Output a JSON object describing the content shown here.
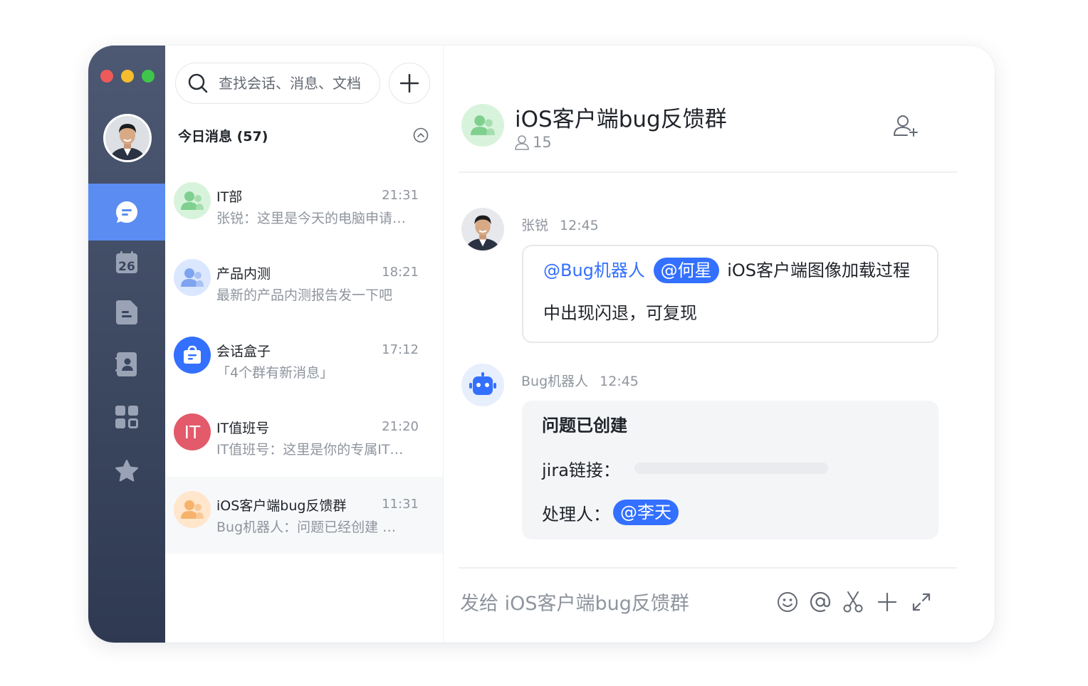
{
  "sidebar": {
    "profile": "avatar",
    "nav": [
      {
        "id": "chat",
        "icon": "chat-bubble-icon",
        "active": true
      },
      {
        "id": "calendar",
        "icon": "calendar-icon",
        "label": "26"
      },
      {
        "id": "docs",
        "icon": "document-icon"
      },
      {
        "id": "contacts",
        "icon": "contacts-icon"
      },
      {
        "id": "workplace",
        "icon": "app-grid-icon"
      },
      {
        "id": "favorites",
        "icon": "star-icon"
      }
    ]
  },
  "search": {
    "placeholder": "查找会话、消息、文档"
  },
  "list": {
    "section_title": "今日消息 (57)",
    "conversations": [
      {
        "name": "IT部",
        "time": "21:31",
        "preview": "张锐：这里是今天的电脑申请…",
        "avatar": "group-icon",
        "avatar_color": "#d8f3dc"
      },
      {
        "name": "产品内测",
        "time": "18:21",
        "preview": "最新的产品内测报告发一下吧",
        "avatar": "group-icon",
        "avatar_color": "#dbe7ff"
      },
      {
        "name": "会话盒子",
        "time": "17:12",
        "preview": "「4个群有新消息」",
        "avatar": "inbox-icon",
        "avatar_color": "#3370ff"
      },
      {
        "name": "IT值班号",
        "time": "21:20",
        "preview": "IT值班号：这里是你的专属IT…",
        "avatar_text": "IT",
        "avatar_color": "#e35a6a"
      },
      {
        "name": "iOS客户端bug反馈群",
        "time": "11:31",
        "preview": "Bug机器人：问题已经创建 …",
        "avatar": "group-icon",
        "avatar_color": "#ffe6cc"
      }
    ]
  },
  "chat": {
    "title": "iOS客户端bug反馈群",
    "member_count": "15",
    "messages": [
      {
        "sender": "张锐",
        "time": "12:45",
        "mention1": "@Bug机器人",
        "mention2": "@何星",
        "text1": "iOS客户端图像加载过程",
        "text2": "中出现闪退，可复现"
      },
      {
        "sender": "Bug机器人",
        "time": "12:45",
        "card_title": "问题已创建",
        "jira_label": "jira链接：",
        "handler_label": "处理人：",
        "handler_mention": "@李天"
      }
    ],
    "compose_placeholder": "发给 iOS客户端bug反馈群"
  },
  "colors": {
    "accent": "#3370ff",
    "rail_top": "#4d5872",
    "rail_bottom": "#2f3a52",
    "active_nav": "#5b8cf2"
  }
}
